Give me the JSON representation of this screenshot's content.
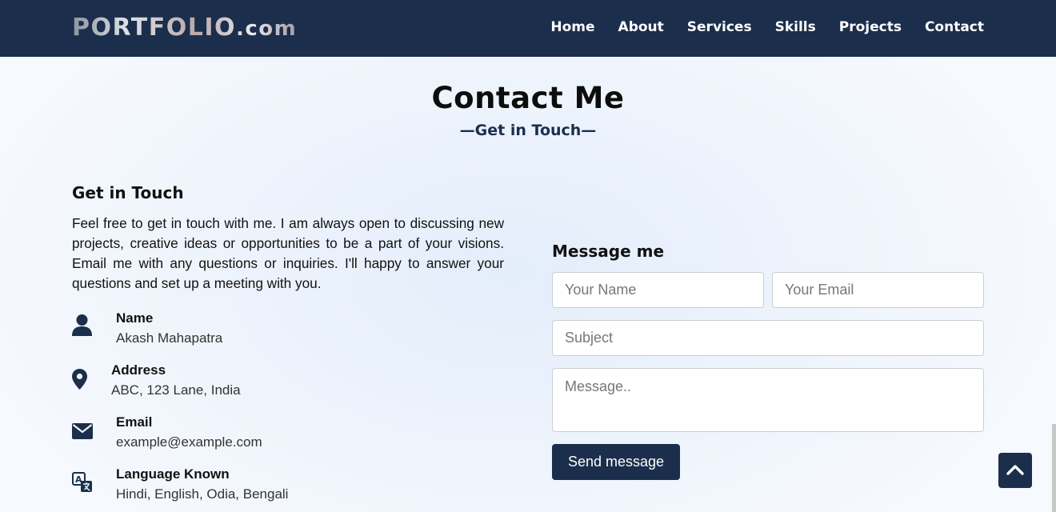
{
  "navbar": {
    "logo_main": "PORTFOLIO",
    "logo_suffix": ".com",
    "links": [
      "Home",
      "About",
      "Services",
      "Skills",
      "Projects",
      "Contact"
    ]
  },
  "section": {
    "title": "Contact Me",
    "subtitle": "—Get in Touch—"
  },
  "info": {
    "heading": "Get in Touch",
    "paragraph": "Feel free to get in touch with me. I am always open to discussing new projects, creative ideas or opportunities to be a part of your visions. Email me with any questions or inquiries. I'll happy to answer your questions and set up a meeting with you.",
    "items": [
      {
        "icon": "user-icon",
        "label": "Name",
        "value": "Akash Mahapatra"
      },
      {
        "icon": "map-marker-icon",
        "label": "Address",
        "value": "ABC, 123 Lane, India"
      },
      {
        "icon": "envelope-icon",
        "label": "Email",
        "value": "example@example.com"
      },
      {
        "icon": "language-icon",
        "label": "Language Known",
        "value": "Hindi, English, Odia, Bengali"
      }
    ]
  },
  "form": {
    "heading": "Message me",
    "name_placeholder": "Your Name",
    "email_placeholder": "Your Email",
    "subject_placeholder": "Subject",
    "message_placeholder": "Message..",
    "submit_label": "Send message"
  },
  "colors": {
    "navbar_bg": "#1b2e4b",
    "accent": "#1b2e4b"
  },
  "scroll_top_icon": "chevron-up-icon"
}
